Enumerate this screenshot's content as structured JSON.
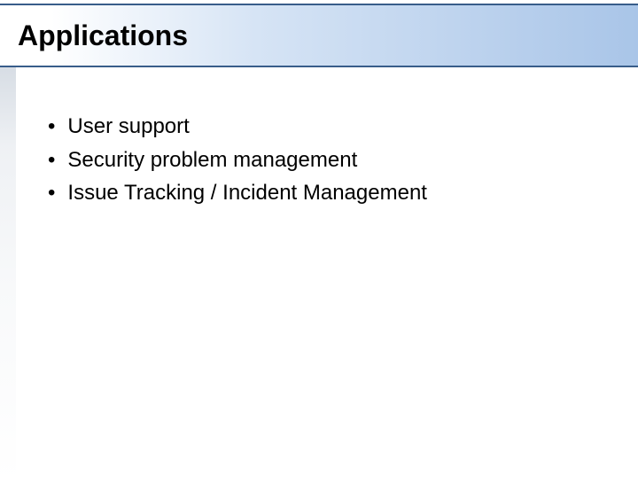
{
  "slide": {
    "title": "Applications",
    "bullets": [
      "User support",
      "Security problem management",
      "Issue Tracking / Incident Management"
    ]
  }
}
